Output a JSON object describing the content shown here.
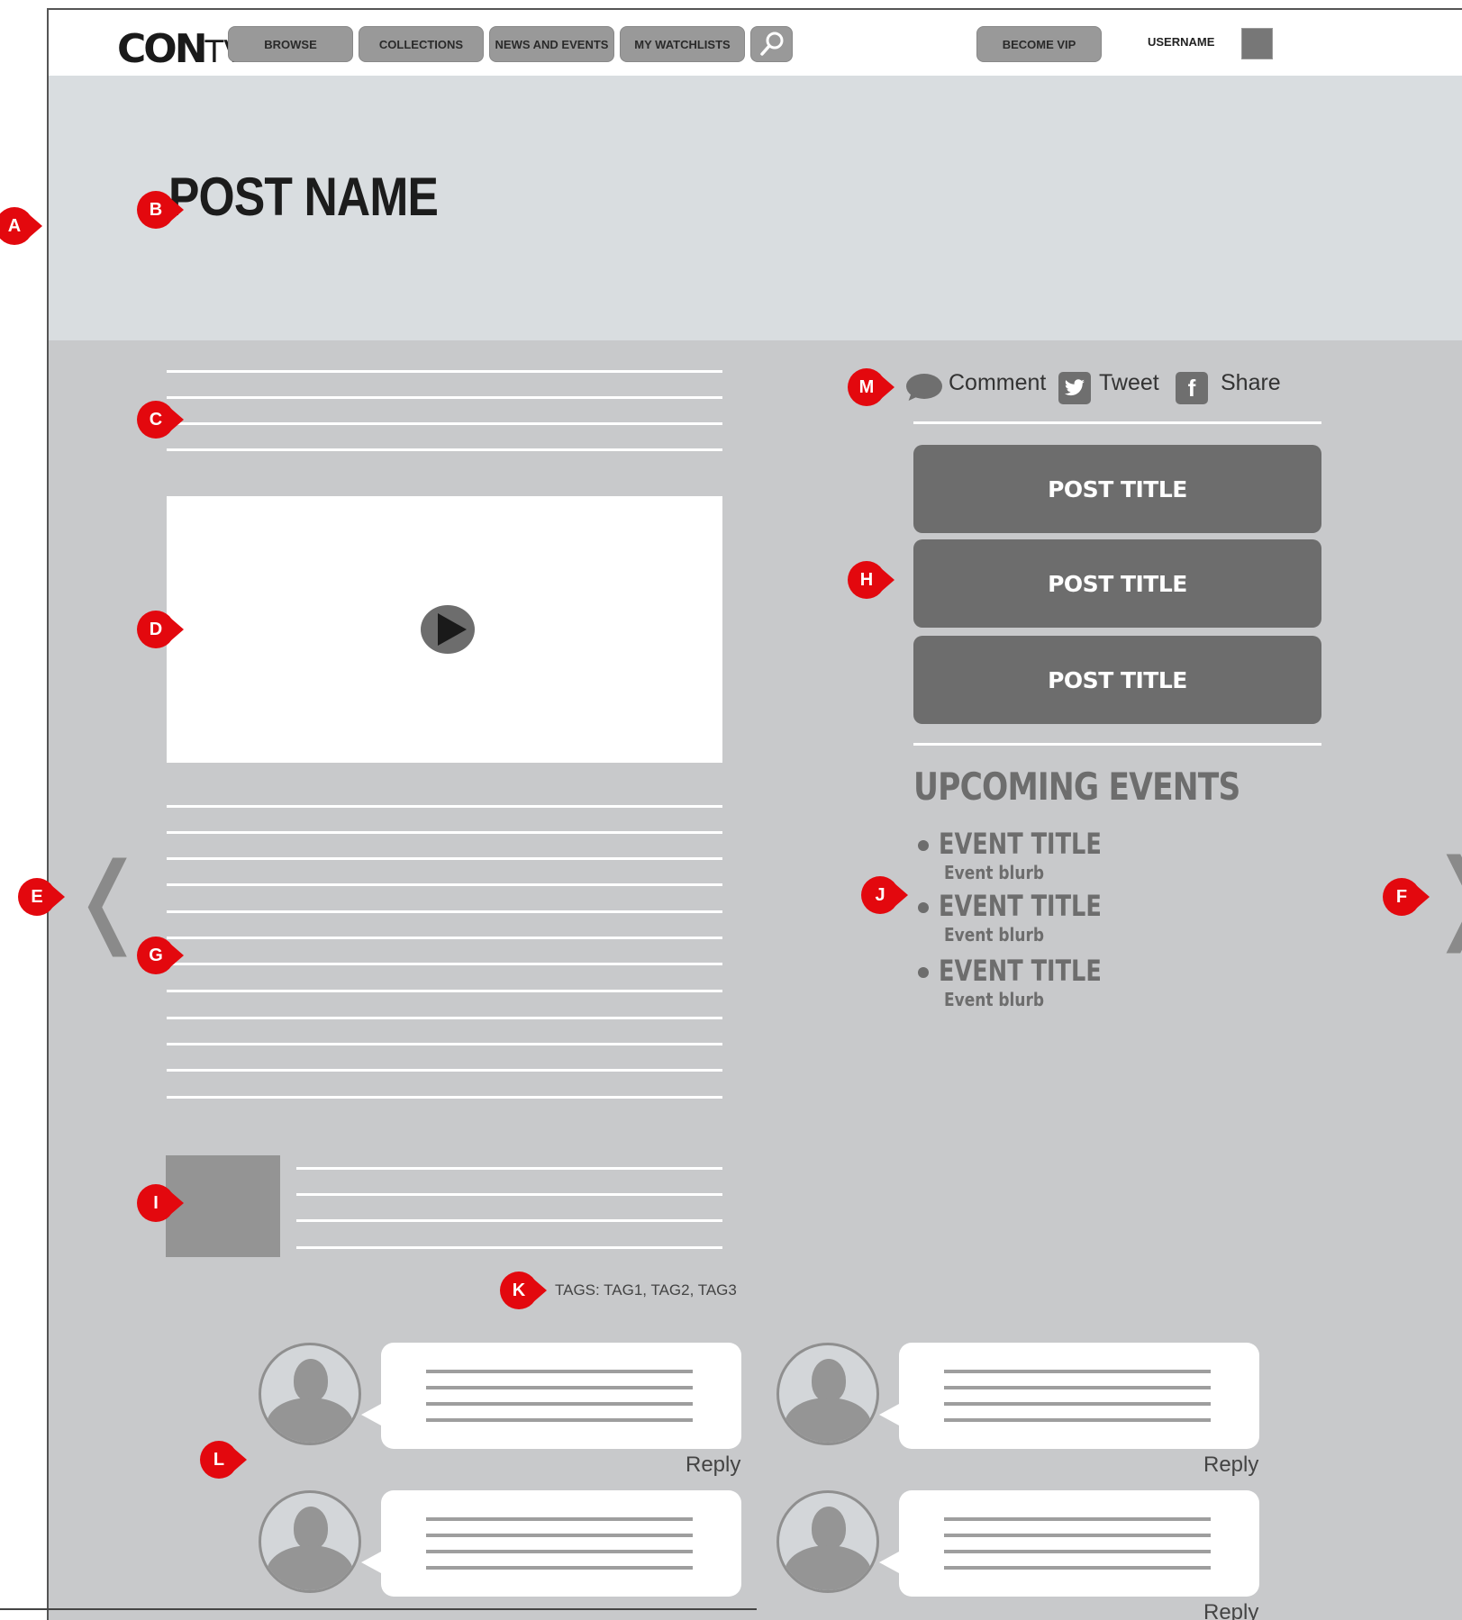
{
  "nav": {
    "logo_main": "CON",
    "logo_suffix": "TV",
    "items": [
      {
        "label": "BROWSE"
      },
      {
        "label": "COLLECTIONS"
      },
      {
        "label": "NEWS AND EVENTS"
      },
      {
        "label": "MY WATCHLISTS"
      }
    ],
    "become_vip": "BECOME VIP",
    "username": "USERNAME"
  },
  "hero": {
    "post_name": "POST NAME"
  },
  "social": {
    "comment": "Comment",
    "tweet": "Tweet",
    "share": "Share"
  },
  "related_posts": [
    {
      "title": "POST TITLE"
    },
    {
      "title": "POST TITLE"
    },
    {
      "title": "POST TITLE"
    }
  ],
  "events": {
    "heading": "UPCOMING EVENTS",
    "items": [
      {
        "title": "EVENT TITLE",
        "blurb": "Event blurb"
      },
      {
        "title": "EVENT TITLE",
        "blurb": "Event blurb"
      },
      {
        "title": "EVENT TITLE",
        "blurb": "Event blurb"
      }
    ]
  },
  "tags_text": "TAGS: TAG1, TAG2, TAG3",
  "comments": {
    "reply_label": "Reply"
  },
  "markers": [
    "A",
    "B",
    "C",
    "D",
    "E",
    "F",
    "G",
    "H",
    "I",
    "J",
    "K",
    "L",
    "M"
  ],
  "colors": {
    "marker": "#e3080e",
    "content_bg": "#c8c9cb",
    "hero_bg": "#d9dde0",
    "button": "#6d6d6d"
  }
}
